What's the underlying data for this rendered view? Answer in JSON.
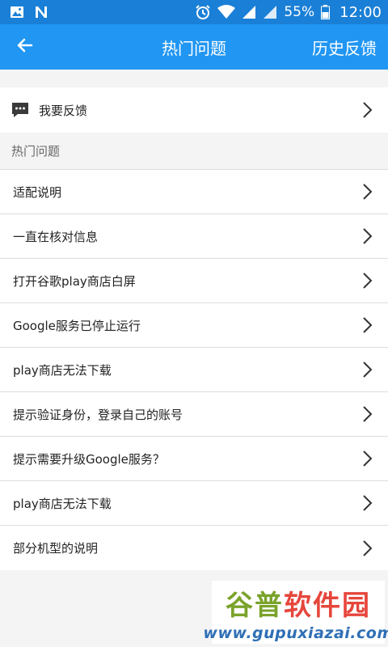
{
  "status_bar": {
    "battery": "55%",
    "time": "12:00",
    "icons": [
      "image-icon",
      "n-app-icon",
      "alarm-icon",
      "wifi-icon",
      "signal-icon",
      "signal-icon-2",
      "battery-icon"
    ]
  },
  "app_bar": {
    "title": "热门问题",
    "history_label": "历史反馈",
    "back_icon": "arrow-left-icon"
  },
  "feedback": {
    "label": "我要反馈",
    "icon": "message-icon"
  },
  "section": {
    "header": "热门问题"
  },
  "faq_items": [
    {
      "label": "适配说明"
    },
    {
      "label": "一直在核对信息"
    },
    {
      "label": "打开谷歌play商店白屏"
    },
    {
      "label": "Google服务已停止运行"
    },
    {
      "label": "play商店无法下载"
    },
    {
      "label": "提示验证身份，登录自己的账号"
    },
    {
      "label": "提示需要升级Google服务？"
    },
    {
      "label": "play商店无法下载"
    },
    {
      "label": "部分机型的说明"
    }
  ],
  "watermark": {
    "title_part1": "谷普",
    "title_part2": "软件园",
    "url": "www.gupuxiazai.com"
  },
  "colors": {
    "primary": "#2196f3",
    "status_bar": "#1a7fd6"
  }
}
